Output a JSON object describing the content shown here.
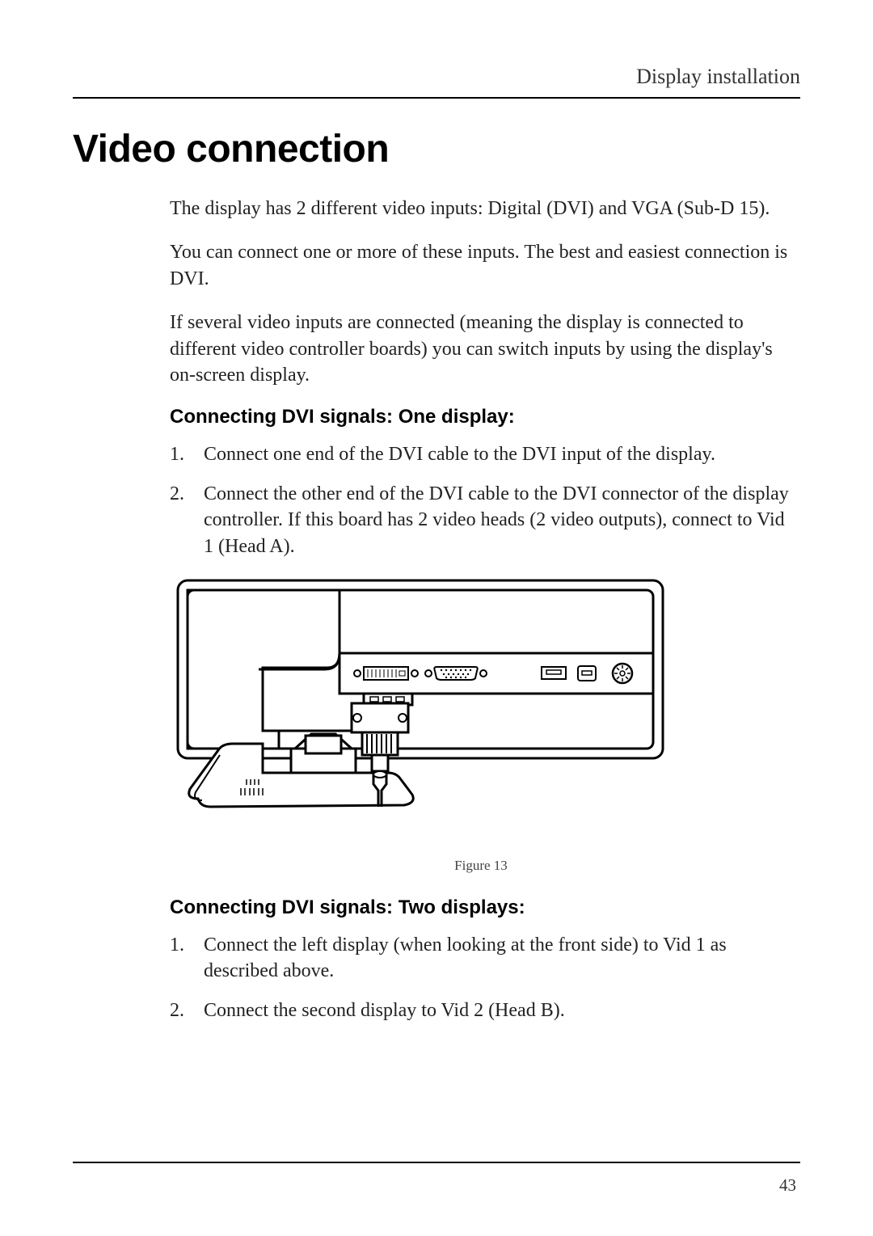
{
  "header": {
    "section": "Display installation"
  },
  "title": "Video connection",
  "paragraphs": {
    "p1": "The display has 2 different video inputs: Digital (DVI) and VGA (Sub-D 15).",
    "p2": "You can connect one or more of these inputs. The best and easiest connection is DVI.",
    "p3": "If several video inputs are connected (meaning the display is connected to different video controller boards) you can switch inputs by using the display's on-screen display."
  },
  "sectionA": {
    "heading": "Connecting DVI signals: One display:",
    "items": [
      {
        "num": "1.",
        "text": "Connect one end of the DVI cable to the DVI input of the display."
      },
      {
        "num": "2.",
        "text": "Connect the other end of the DVI cable to the DVI connector of the display controller. If this board has 2 video heads (2 video outputs), connect to Vid 1 (Head A)."
      }
    ]
  },
  "figure": {
    "caption": "Figure 13"
  },
  "sectionB": {
    "heading": "Connecting DVI signals: Two displays:",
    "items": [
      {
        "num": "1.",
        "text": "Connect the left display (when looking at the front side) to Vid 1 as described above."
      },
      {
        "num": "2.",
        "text": "Connect the second display to Vid 2 (Head B)."
      }
    ]
  },
  "pageNumber": "43"
}
